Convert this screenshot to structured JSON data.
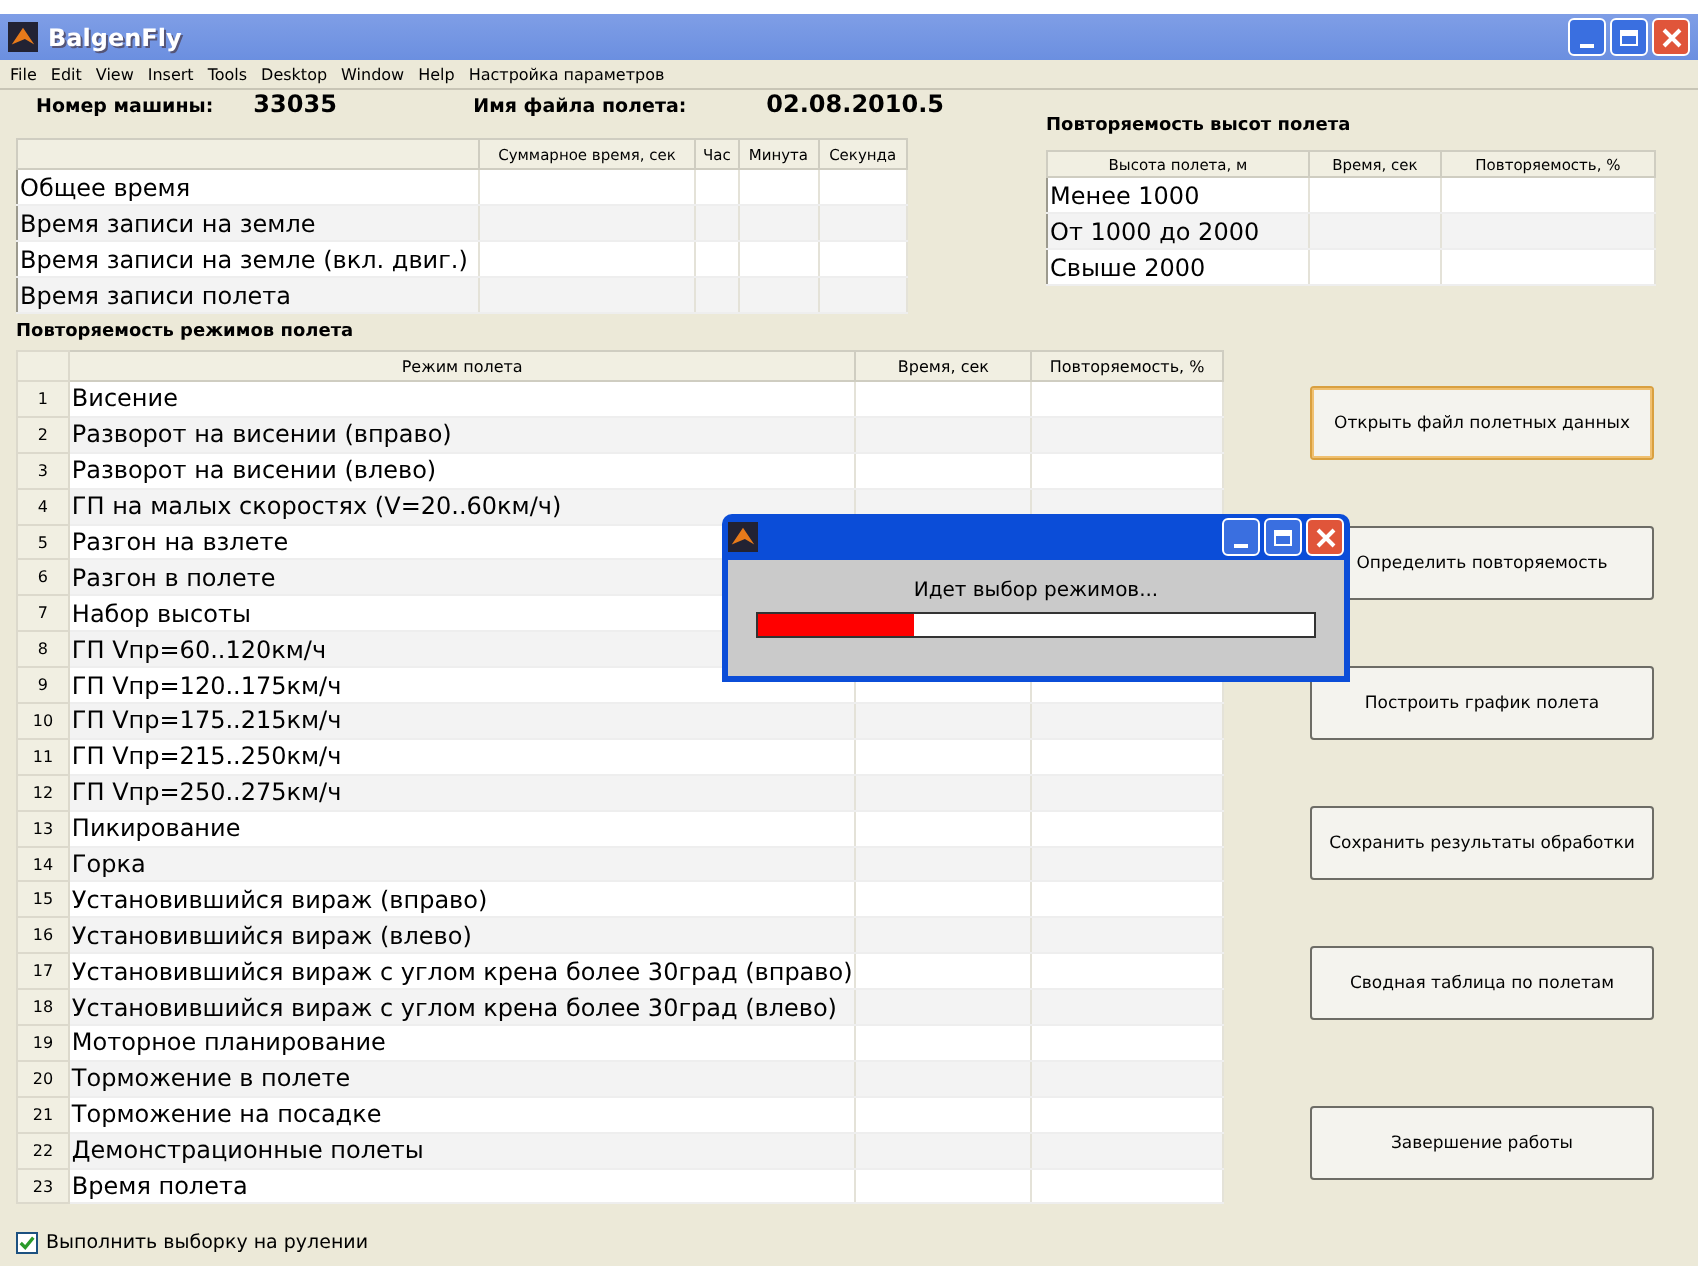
{
  "window": {
    "title": "BalgenFly"
  },
  "menu": [
    "File",
    "Edit",
    "View",
    "Insert",
    "Tools",
    "Desktop",
    "Window",
    "Help",
    "Настройка параметров"
  ],
  "header": {
    "machine_label": "Номер машины:",
    "machine_value": "33035",
    "file_label": "Имя файла полета:",
    "file_value": "02.08.2010.5"
  },
  "time_table": {
    "columns": [
      "Суммарное время, сек",
      "Час",
      "Минута",
      "Секунда"
    ],
    "rows": [
      "Общее время",
      "Время записи на земле",
      "Время записи на земле (вкл. двиг.)",
      "Время записи полета"
    ]
  },
  "altitude": {
    "title": "Повторяемость высот полета",
    "columns": [
      "Высота полета, м",
      "Время, сек",
      "Повторяемость, %"
    ],
    "rows": [
      "Менее 1000",
      "От 1000 до 2000",
      "Свыше 2000"
    ]
  },
  "modes": {
    "title": "Повторяемость режимов полета",
    "columns": [
      "Режим полета",
      "Время, сек",
      "Повторяемость, %"
    ],
    "rows": [
      {
        "number": "1",
        "name": "Висение"
      },
      {
        "number": "2",
        "name": "Разворот на висении (вправо)"
      },
      {
        "number": "3",
        "name": "Разворот на висении (влево)"
      },
      {
        "number": "4",
        "name": "ГП на малых скоростях (V=20..60км/ч)"
      },
      {
        "number": "5",
        "name": "Разгон на взлете"
      },
      {
        "number": "6",
        "name": "Разгон в полете"
      },
      {
        "number": "7",
        "name": "Набор высоты"
      },
      {
        "number": "8",
        "name": "ГП Vпр=60..120км/ч"
      },
      {
        "number": "9",
        "name": "ГП Vпр=120..175км/ч"
      },
      {
        "number": "10",
        "name": "ГП Vпр=175..215км/ч"
      },
      {
        "number": "11",
        "name": "ГП Vпр=215..250км/ч"
      },
      {
        "number": "12",
        "name": "ГП Vпр=250..275км/ч"
      },
      {
        "number": "13",
        "name": "Пикирование"
      },
      {
        "number": "14",
        "name": "Горка"
      },
      {
        "number": "15",
        "name": "Установившийся вираж (вправо)"
      },
      {
        "number": "16",
        "name": "Установившийся вираж (влево)"
      },
      {
        "number": "17",
        "name": "Установившийся вираж с углом крена более 30град (вправо)"
      },
      {
        "number": "18",
        "name": "Установившийся вираж с углом крена более 30град (влево)"
      },
      {
        "number": "19",
        "name": "Моторное планирование"
      },
      {
        "number": "20",
        "name": "Торможение в полете"
      },
      {
        "number": "21",
        "name": "Торможение на посадке"
      },
      {
        "number": "22",
        "name": "Демонстрационные полеты"
      },
      {
        "number": "23",
        "name": "Время полета"
      }
    ]
  },
  "buttons": [
    "Открыть файл полетных данных",
    "Определить повторяемость",
    "Построить график полета",
    "Сохранить результаты обработки",
    "Сводная таблица по полетам",
    "Завершение работы"
  ],
  "taxi_checkbox": {
    "label": "Выполнить выборку на рулении",
    "checked": true
  },
  "progress_dialog": {
    "message": "Идет выбор режимов...",
    "level": 0.28
  }
}
